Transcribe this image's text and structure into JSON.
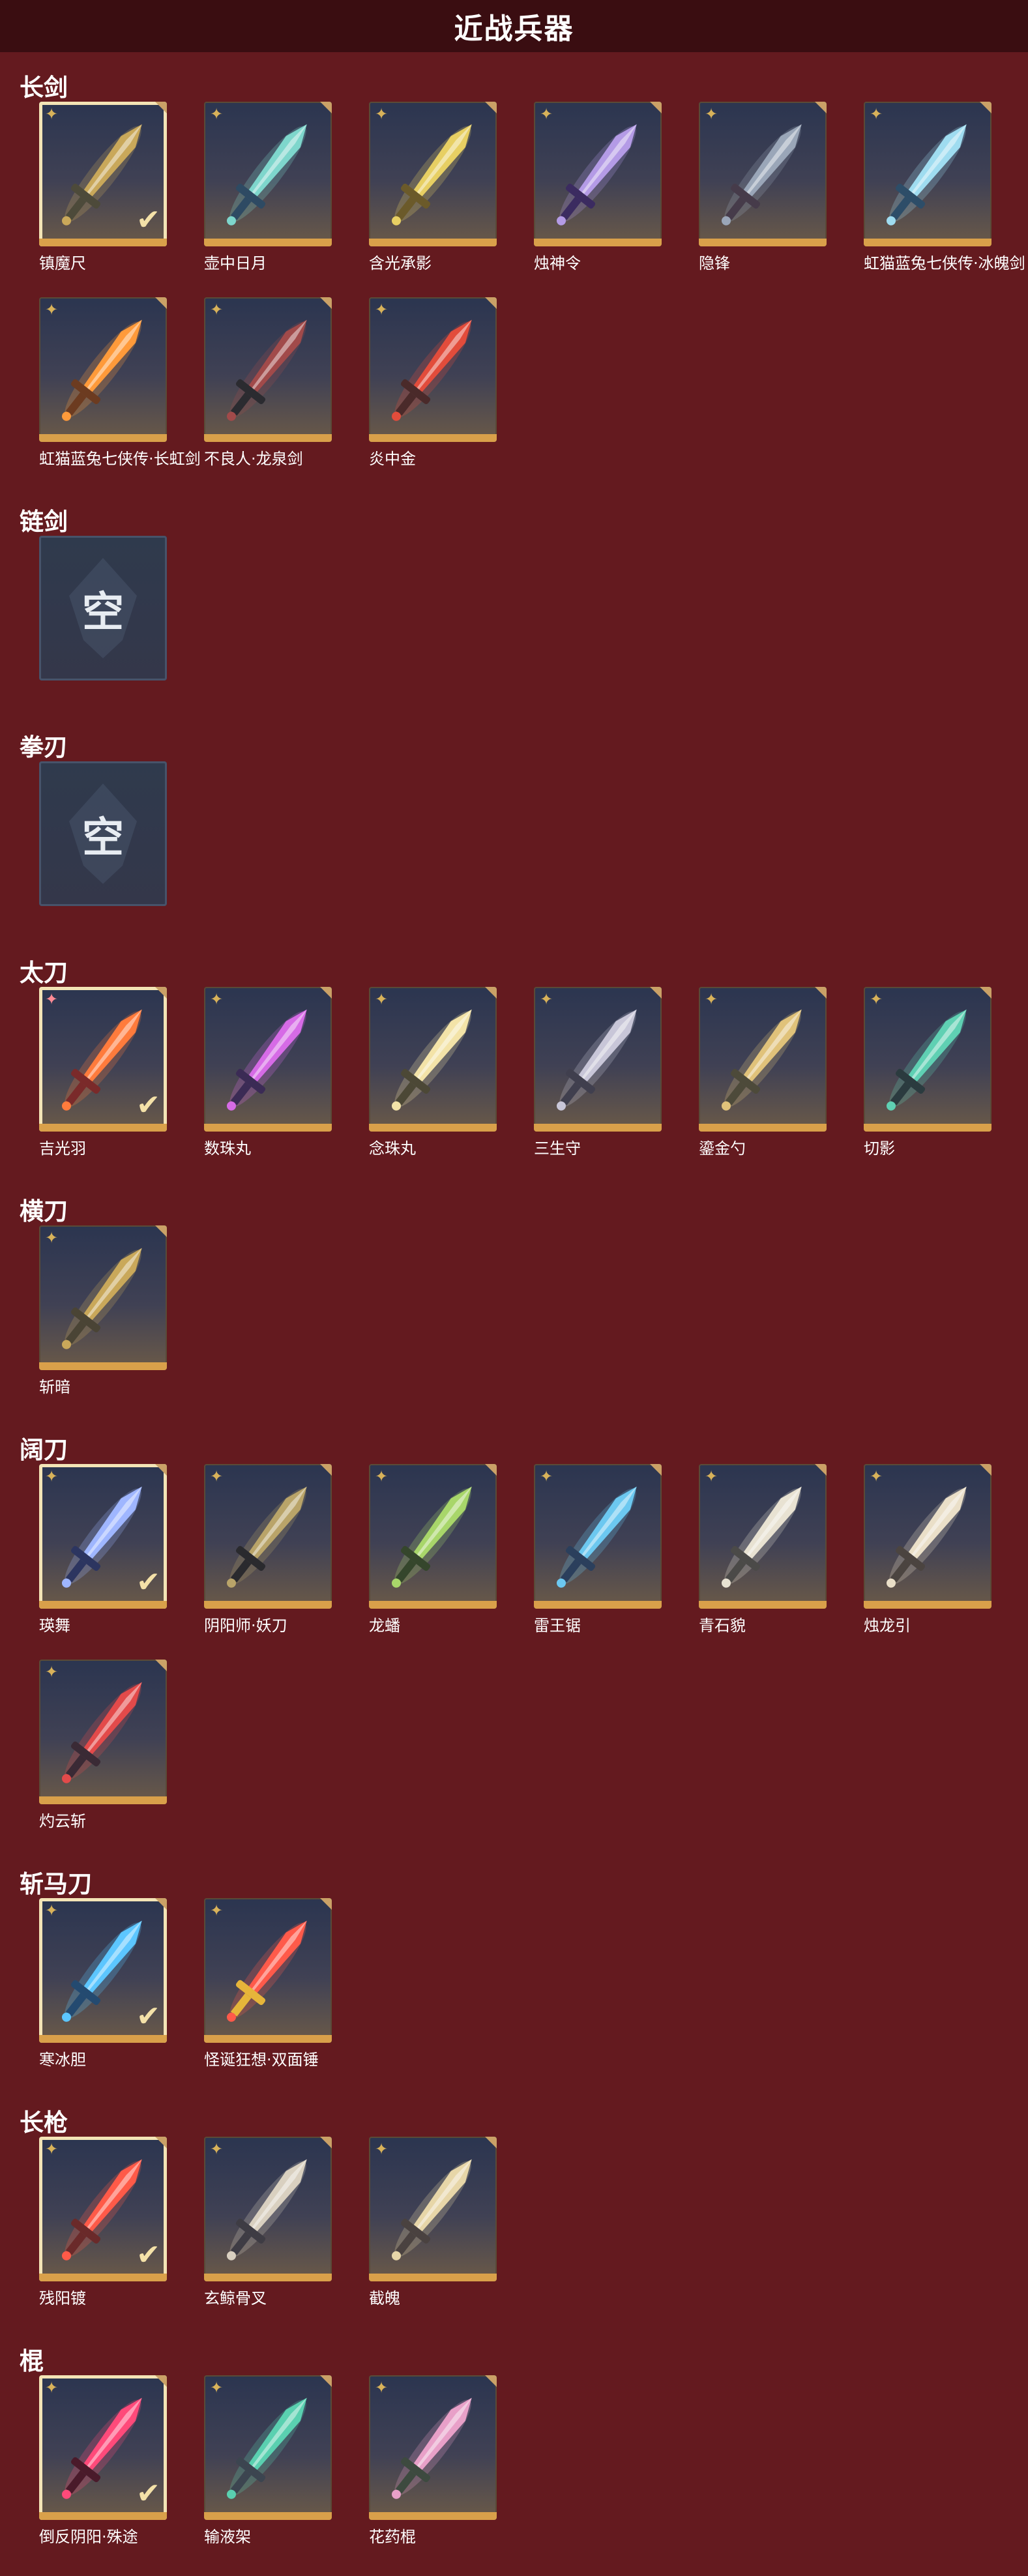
{
  "page": {
    "title": "近战兵器"
  },
  "icons": {
    "star": "✦",
    "check": "✔"
  },
  "sections": [
    {
      "id": "long-sword",
      "name": "长剑",
      "items": [
        {
          "label": "镇魔尺",
          "equipped": true,
          "rarity": "gold",
          "colors": [
            "#c9a85a",
            "#4d4a3a"
          ]
        },
        {
          "label": "壶中日月",
          "equipped": false,
          "rarity": "gold",
          "colors": [
            "#7ed6cc",
            "#2e4a63"
          ]
        },
        {
          "label": "含光承影",
          "equipped": false,
          "rarity": "gold",
          "colors": [
            "#e7cf63",
            "#6b5a2a"
          ]
        },
        {
          "label": "烛神令",
          "equipped": false,
          "rarity": "gold",
          "colors": [
            "#b49be6",
            "#3b2b60"
          ]
        },
        {
          "label": "隐锋",
          "equipped": false,
          "rarity": "gold",
          "colors": [
            "#9aa6b8",
            "#463b4a"
          ]
        },
        {
          "label": "虹猫蓝兔七侠传·冰魄剑",
          "equipped": false,
          "rarity": "gold",
          "colors": [
            "#9fdcf0",
            "#2d4d68"
          ]
        },
        {
          "label": "虹猫蓝兔七侠传·长虹剑",
          "equipped": false,
          "rarity": "gold",
          "colors": [
            "#ff9a3a",
            "#6c3b20"
          ]
        },
        {
          "label": "不良人·龙泉剑",
          "equipped": false,
          "rarity": "gold",
          "colors": [
            "#a14a4a",
            "#2b2b30"
          ]
        },
        {
          "label": "炎中金",
          "equipped": false,
          "rarity": "gold",
          "colors": [
            "#e24c3b",
            "#4a2a2a"
          ]
        }
      ]
    },
    {
      "id": "chain-sword",
      "name": "链剑",
      "empty": true,
      "empty_text": "空"
    },
    {
      "id": "fist-blade",
      "name": "拳刃",
      "empty": true,
      "empty_text": "空"
    },
    {
      "id": "katana",
      "name": "太刀",
      "items": [
        {
          "label": "吉光羽",
          "equipped": true,
          "rarity": "pink",
          "colors": [
            "#ff7b3c",
            "#7a2a2a"
          ]
        },
        {
          "label": "数珠丸",
          "equipped": false,
          "rarity": "gold",
          "colors": [
            "#d66be6",
            "#3b2b55"
          ]
        },
        {
          "label": "念珠丸",
          "equipped": false,
          "rarity": "gold",
          "colors": [
            "#f3e3a8",
            "#4c4836"
          ]
        },
        {
          "label": "三生守",
          "equipped": false,
          "rarity": "gold",
          "colors": [
            "#c8c6d8",
            "#403f4e"
          ]
        },
        {
          "label": "鎏金勺",
          "equipped": false,
          "rarity": "gold",
          "colors": [
            "#e0c27a",
            "#4d4a3a"
          ]
        },
        {
          "label": "切影",
          "equipped": false,
          "rarity": "gold",
          "colors": [
            "#5fd0b3",
            "#2b3b3f"
          ]
        }
      ]
    },
    {
      "id": "horizontal-blade",
      "name": "横刀",
      "items": [
        {
          "label": "斩暗",
          "equipped": false,
          "rarity": "gold",
          "colors": [
            "#c9a85a",
            "#4a4435"
          ]
        }
      ]
    },
    {
      "id": "broad-blade",
      "name": "阔刀",
      "items": [
        {
          "label": "瑛舞",
          "equipped": true,
          "rarity": "gold",
          "colors": [
            "#9fb6ff",
            "#2c3560"
          ]
        },
        {
          "label": "阴阳师·妖刀",
          "equipped": false,
          "rarity": "gold",
          "colors": [
            "#b9a469",
            "#2a2a2e"
          ]
        },
        {
          "label": "龙蟠",
          "equipped": false,
          "rarity": "gold",
          "colors": [
            "#a8d66a",
            "#35462c"
          ]
        },
        {
          "label": "雷王锯",
          "equipped": false,
          "rarity": "gold",
          "colors": [
            "#6cc8f0",
            "#2b3f5c"
          ]
        },
        {
          "label": "青石貌",
          "equipped": false,
          "rarity": "gold",
          "colors": [
            "#e8e2d2",
            "#4b4a48"
          ]
        },
        {
          "label": "烛龙引",
          "equipped": false,
          "rarity": "gold",
          "colors": [
            "#eadfc8",
            "#4b4440"
          ]
        },
        {
          "label": "灼云斩",
          "equipped": false,
          "rarity": "gold",
          "colors": [
            "#e34a4a",
            "#3a2a35"
          ]
        }
      ]
    },
    {
      "id": "horse-chopper",
      "name": "斩马刀",
      "items": [
        {
          "label": "寒冰胆",
          "equipped": true,
          "rarity": "gold",
          "colors": [
            "#5cc6ff",
            "#244a70"
          ]
        },
        {
          "label": "怪诞狂想·双面锤",
          "equipped": false,
          "rarity": "gold",
          "colors": [
            "#ff5a4a",
            "#e6b53a"
          ]
        }
      ]
    },
    {
      "id": "spear",
      "name": "长枪",
      "items": [
        {
          "label": "残阳镀",
          "equipped": true,
          "rarity": "gold",
          "colors": [
            "#ff5a48",
            "#6a2a2a"
          ]
        },
        {
          "label": "玄鲸骨叉",
          "equipped": false,
          "rarity": "gold",
          "colors": [
            "#d9d0c0",
            "#3e3c44"
          ]
        },
        {
          "label": "截魄",
          "equipped": false,
          "rarity": "gold",
          "colors": [
            "#e7d6a8",
            "#4a4240"
          ]
        }
      ]
    },
    {
      "id": "staff",
      "name": "棍",
      "items": [
        {
          "label": "倒反阴阳·殊途",
          "equipped": true,
          "rarity": "gold",
          "colors": [
            "#ff4a7a",
            "#4a1a2a"
          ]
        },
        {
          "label": "输液架",
          "equipped": false,
          "rarity": "gold",
          "colors": [
            "#5ad0b0",
            "#3c4550"
          ]
        },
        {
          "label": "花药棍",
          "equipped": false,
          "rarity": "gold",
          "colors": [
            "#e8a0c8",
            "#3d4a3f"
          ]
        }
      ]
    }
  ]
}
